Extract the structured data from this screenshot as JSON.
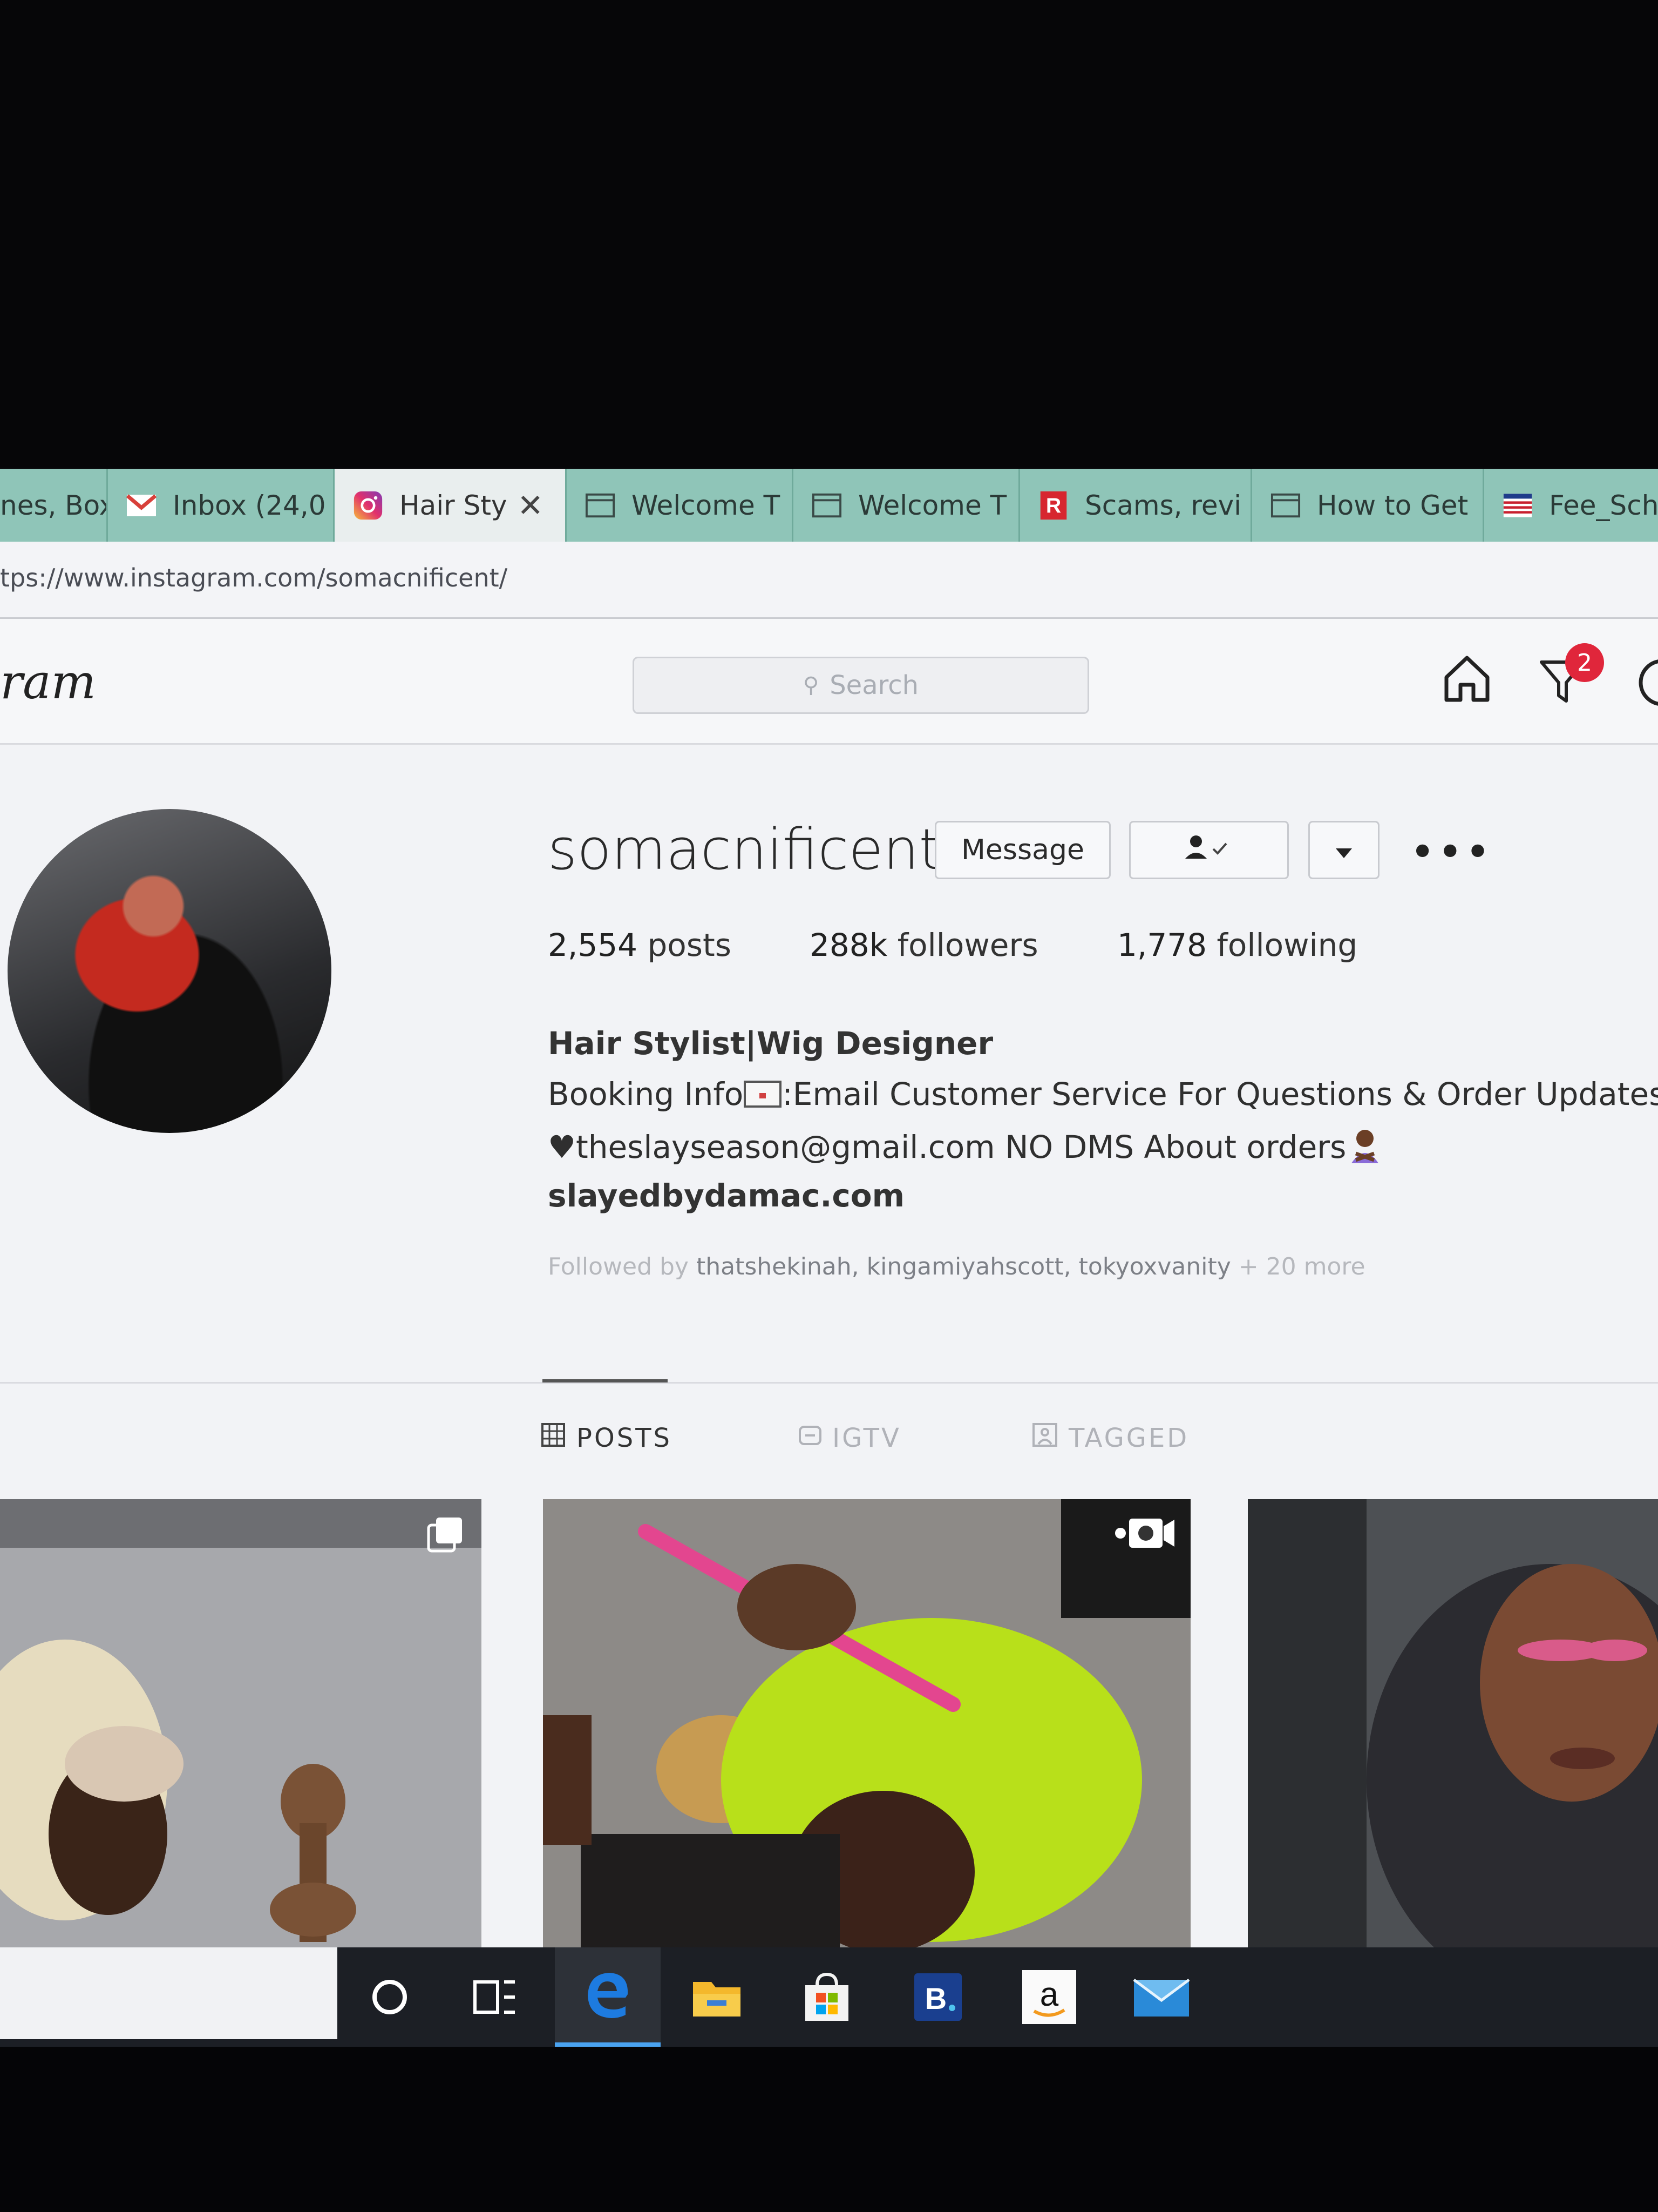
{
  "browser": {
    "tabs": [
      {
        "label": "nes, Box",
        "icon": "generic-icon"
      },
      {
        "label": "Inbox (24,0",
        "icon": "gmail-icon"
      },
      {
        "label": "Hair Sty",
        "icon": "instagram-icon",
        "active": true
      },
      {
        "label": "Welcome T",
        "icon": "page-icon"
      },
      {
        "label": "Welcome T",
        "icon": "page-icon"
      },
      {
        "label": "Scams, revi",
        "icon": "ripoff-report-icon"
      },
      {
        "label": "How to Get",
        "icon": "page-icon"
      },
      {
        "label": "Fee_Sch",
        "icon": "flag-icon"
      }
    ],
    "url": "tps://www.instagram.com/somacnificent/"
  },
  "instagram": {
    "logo_fragment": "ram",
    "search_placeholder": "Search",
    "notification_count": "2",
    "profile": {
      "username": "somacnificent",
      "message_button": "Message",
      "stats": {
        "posts_count": "2,554",
        "posts_label": "posts",
        "followers_count": "288k",
        "followers_label": "followers",
        "following_count": "1,778",
        "following_label": "following"
      },
      "bio": {
        "line1": "Hair Stylist|Wig Designer",
        "line2_prefix": "Booking Info",
        "line2_suffix": ":Email Customer Service For Questions & Order Updates",
        "line3": "♥theslayseason@gmail.com NO DMS About orders",
        "website": "slayedbydamac.com"
      },
      "followed_by": {
        "prefix": "Followed by",
        "names": "thatshekinah, kingamiyahscott, tokyoxvanity",
        "more": "+ 20 more"
      }
    },
    "tabs": {
      "posts": "POSTS",
      "igtv": "IGTV",
      "tagged": "TAGGED"
    }
  },
  "taskbar": {
    "apps": [
      "cortana-icon",
      "task-view-icon",
      "edge-icon",
      "file-explorer-icon",
      "store-icon",
      "booking-icon",
      "amazon-icon",
      "mail-icon"
    ]
  }
}
